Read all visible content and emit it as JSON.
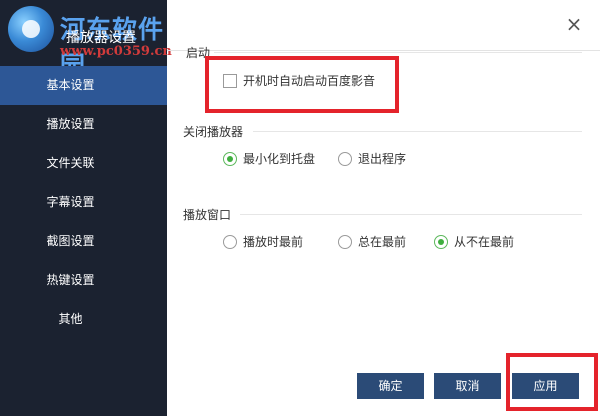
{
  "watermark": {
    "title": "河东软件园",
    "url": "www.pc0359.cn"
  },
  "window": {
    "title": "播放器设置"
  },
  "sidebar": {
    "items": [
      {
        "label": "基本设置"
      },
      {
        "label": "播放设置"
      },
      {
        "label": "文件关联"
      },
      {
        "label": "字幕设置"
      },
      {
        "label": "截图设置"
      },
      {
        "label": "热键设置"
      },
      {
        "label": "其他"
      }
    ],
    "active_index": 0
  },
  "sections": {
    "startup": {
      "title": "启动",
      "checkbox_label": "开机时自动启动百度影音",
      "checked": false
    },
    "close_player": {
      "title": "关闭播放器",
      "options": [
        "最小化到托盘",
        "退出程序"
      ],
      "selected_index": 0
    },
    "play_window": {
      "title": "播放窗口",
      "options": [
        "播放时最前",
        "总在最前",
        "从不在最前"
      ],
      "selected_index": 2
    }
  },
  "buttons": {
    "ok": "确定",
    "cancel": "取消",
    "apply": "应用"
  },
  "colors": {
    "sidebar_bg": "#1b2230",
    "active_item": "#2d5796",
    "button_bg": "#2b4b77",
    "radio_checked": "#3fae3f",
    "highlight": "#e4232b"
  }
}
